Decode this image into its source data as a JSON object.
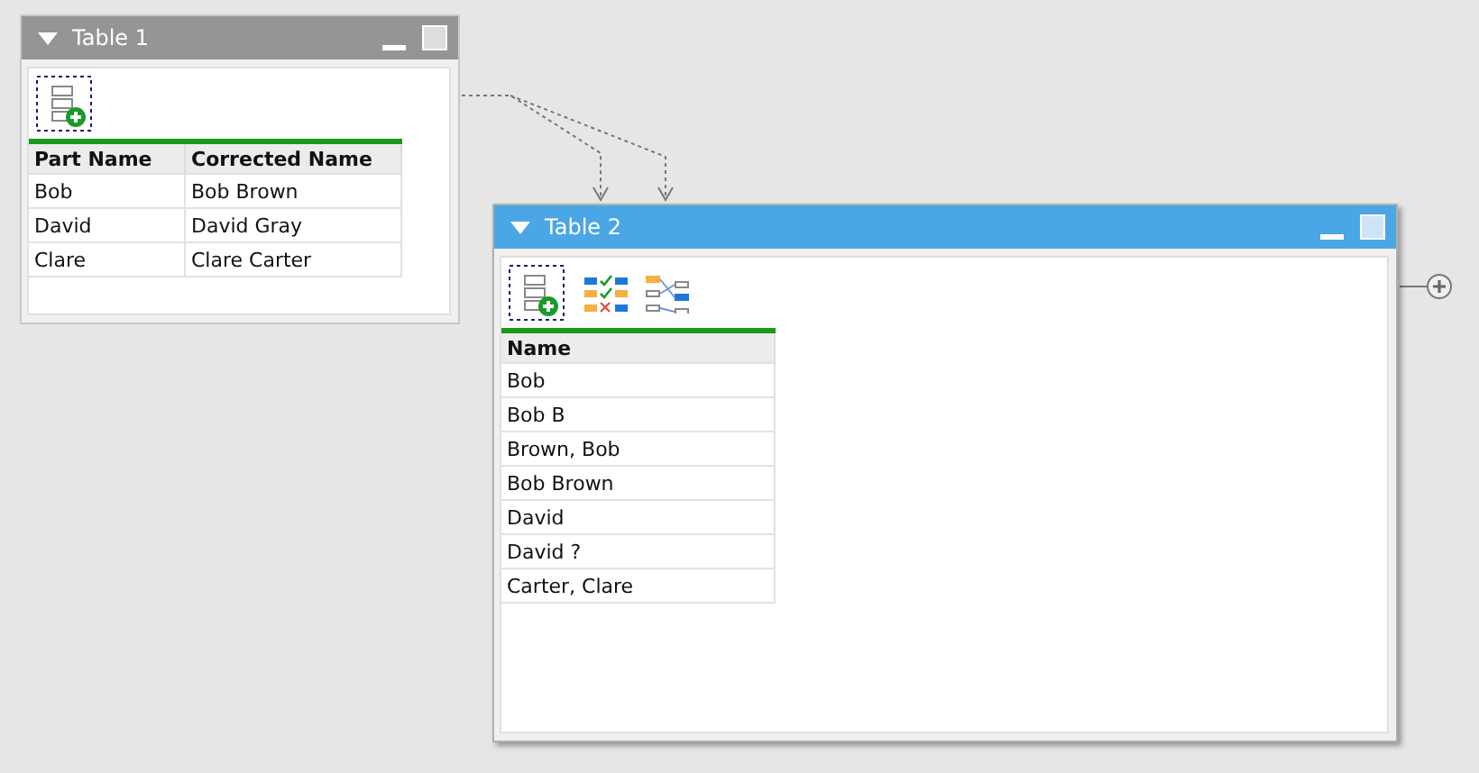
{
  "tables": [
    {
      "title": "Table 1",
      "selected": false,
      "tools": [
        {
          "kind": "add"
        }
      ],
      "columns": [
        "Part Name",
        "Corrected Name"
      ],
      "rows": [
        [
          "Bob",
          "Bob Brown"
        ],
        [
          "David",
          "David Gray"
        ],
        [
          "Clare",
          "Clare Carter"
        ]
      ]
    },
    {
      "title": "Table 2",
      "selected": true,
      "tools": [
        {
          "kind": "add"
        },
        {
          "kind": "checklist"
        },
        {
          "kind": "mapping"
        }
      ],
      "columns": [
        "Name"
      ],
      "rows": [
        [
          "Bob"
        ],
        [
          "Bob B"
        ],
        [
          "Brown, Bob"
        ],
        [
          "Bob Brown"
        ],
        [
          "David"
        ],
        [
          "David ?"
        ],
        [
          "Carter, Clare"
        ]
      ]
    }
  ]
}
